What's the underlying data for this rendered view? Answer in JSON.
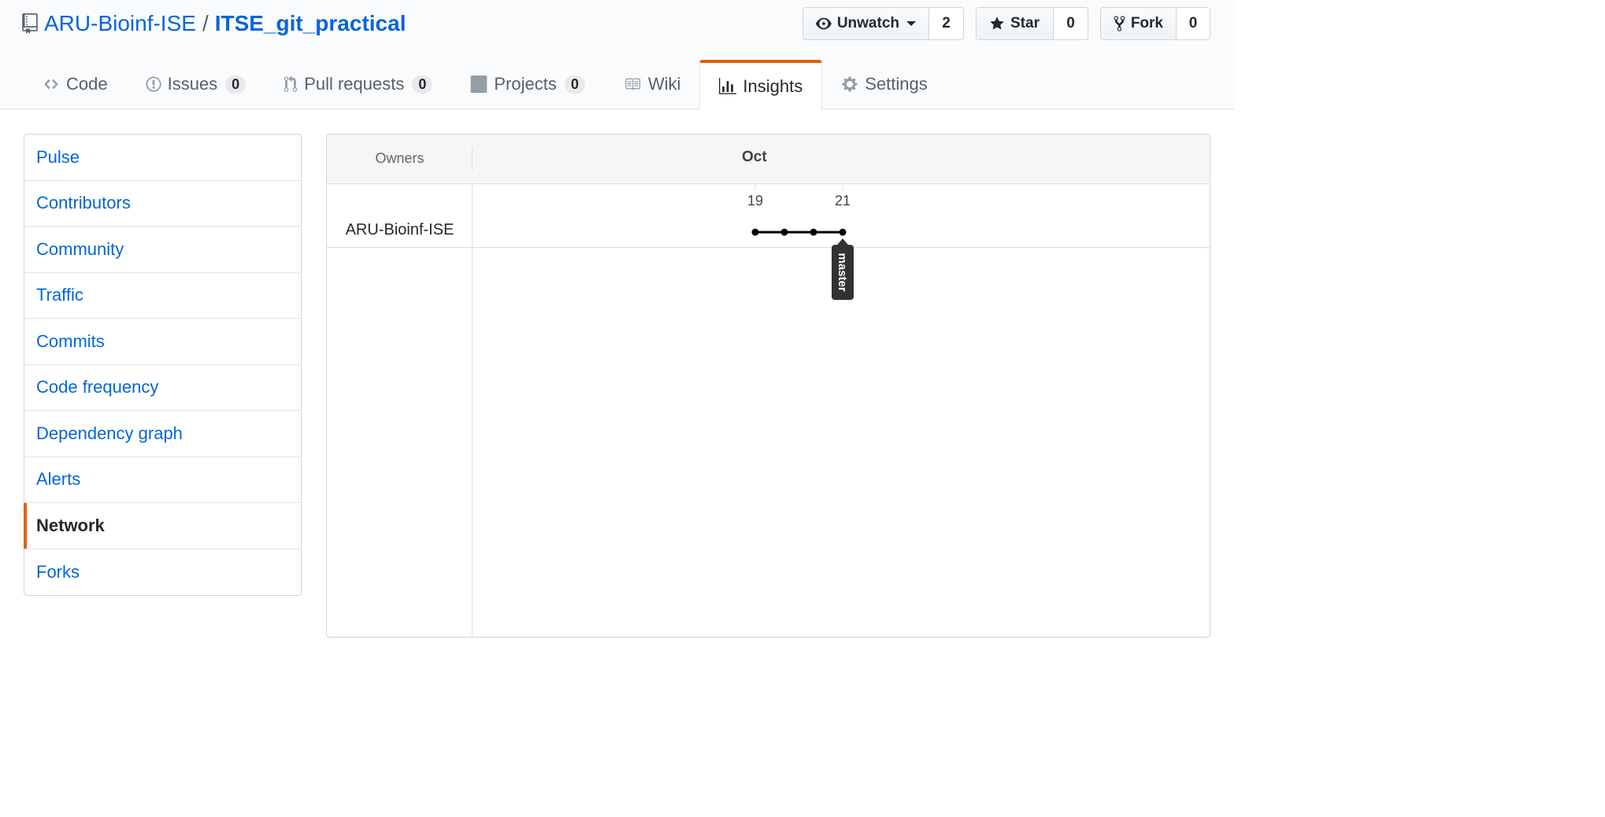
{
  "header": {
    "owner": "ARU-Bioinf-ISE",
    "separator": "/",
    "repo": "ITSE_git_practical",
    "watch": {
      "label": "Unwatch",
      "count": "2"
    },
    "star": {
      "label": "Star",
      "count": "0"
    },
    "fork": {
      "label": "Fork",
      "count": "0"
    }
  },
  "tabs": [
    {
      "label": "Code",
      "icon": "code-icon"
    },
    {
      "label": "Issues",
      "count": "0",
      "icon": "issue-icon"
    },
    {
      "label": "Pull requests",
      "count": "0",
      "icon": "pull-request-icon"
    },
    {
      "label": "Projects",
      "count": "0",
      "icon": "project-icon"
    },
    {
      "label": "Wiki",
      "icon": "book-icon"
    },
    {
      "label": "Insights",
      "icon": "graph-icon",
      "selected": true
    },
    {
      "label": "Settings",
      "icon": "gear-icon"
    }
  ],
  "sidebar": {
    "items": [
      {
        "label": "Pulse"
      },
      {
        "label": "Contributors"
      },
      {
        "label": "Community"
      },
      {
        "label": "Traffic"
      },
      {
        "label": "Commits"
      },
      {
        "label": "Code frequency"
      },
      {
        "label": "Dependency graph"
      },
      {
        "label": "Alerts"
      },
      {
        "label": "Network",
        "selected": true
      },
      {
        "label": "Forks"
      }
    ]
  },
  "network": {
    "owners_label": "Owners",
    "month": "Oct",
    "days": [
      "19",
      "21"
    ],
    "owner": "ARU-Bioinf-ISE",
    "commits_count": 4,
    "branch": "master"
  },
  "colors": {
    "link": "#0366d6",
    "accent": "#e36209",
    "border": "#d1d5da"
  }
}
